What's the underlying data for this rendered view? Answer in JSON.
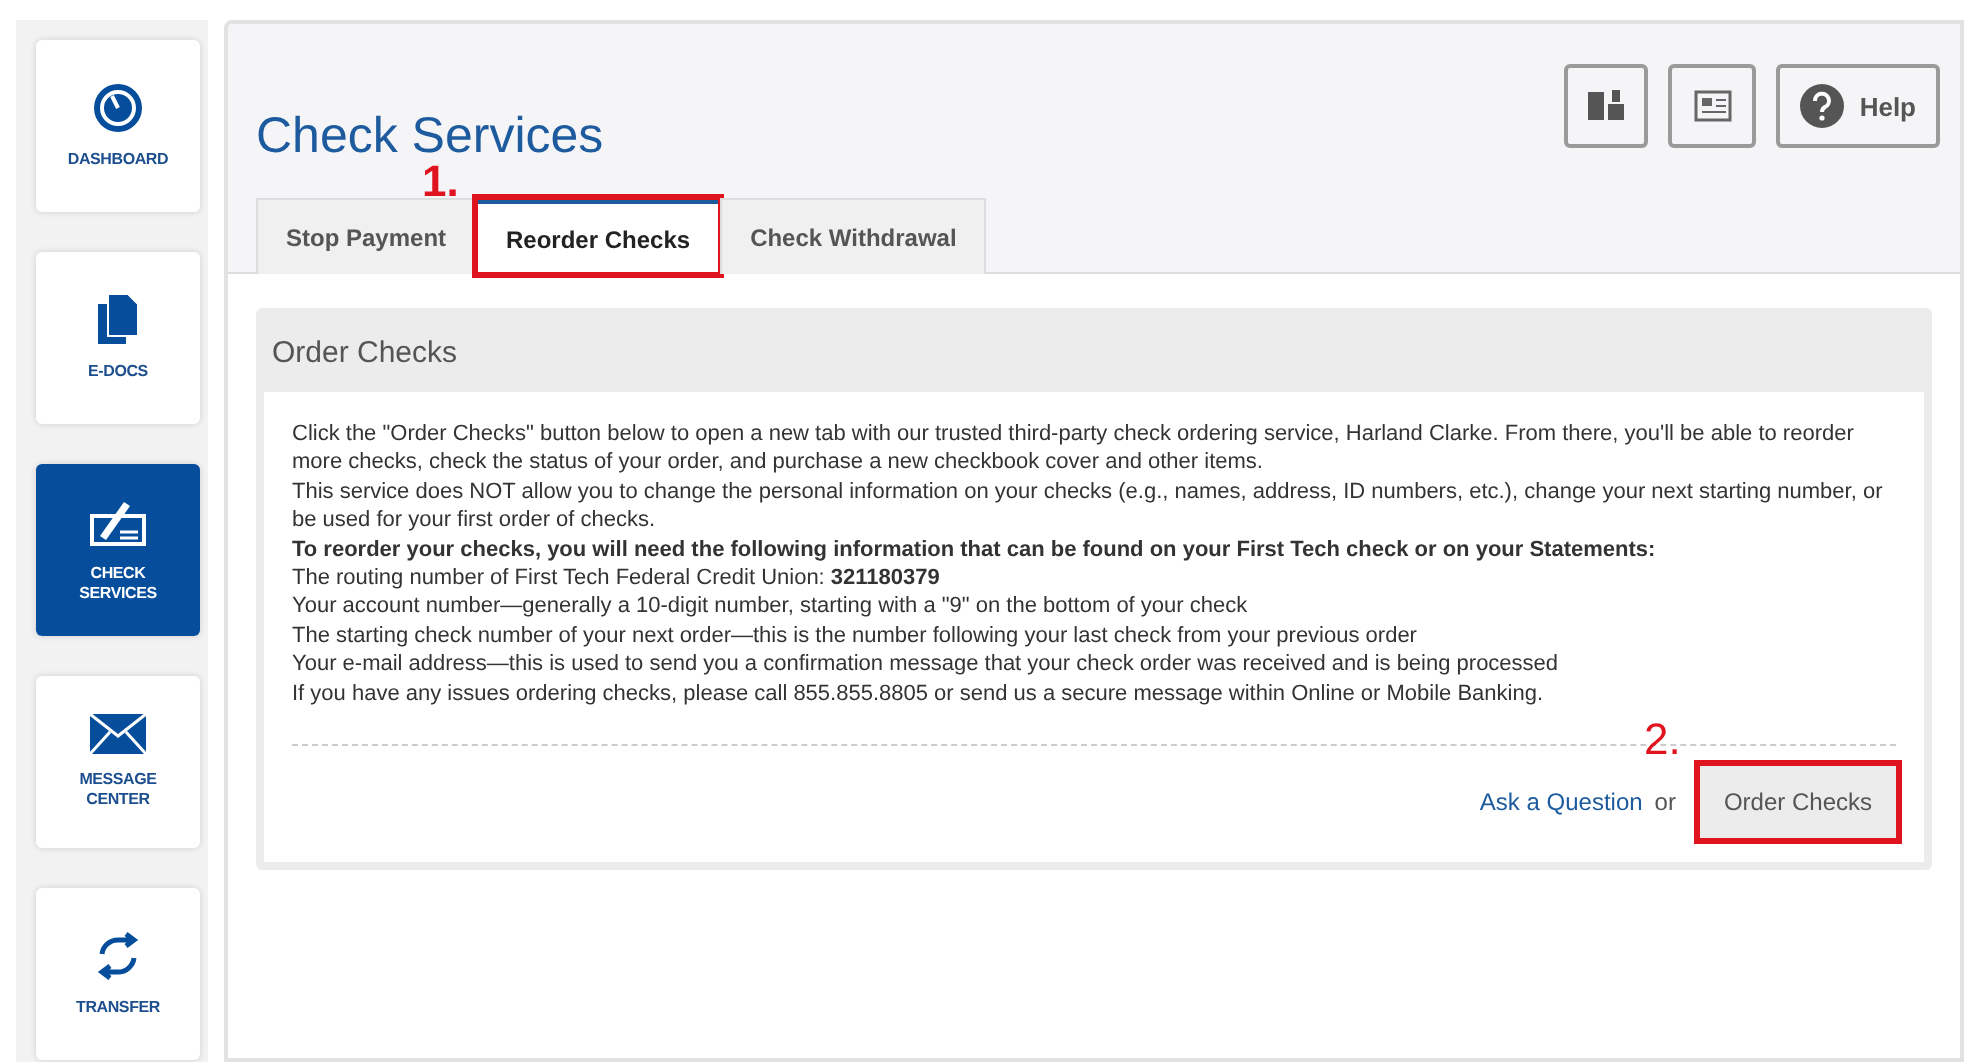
{
  "sidebar": {
    "items": [
      {
        "label": "DASHBOARD",
        "kind": "gauge",
        "selected": false
      },
      {
        "label": "E-DOCS",
        "kind": "docs",
        "selected": false
      },
      {
        "label": "CHECK SERVICES",
        "kind": "check",
        "selected": true
      },
      {
        "label": "MESSAGE CENTER",
        "kind": "mail",
        "selected": false
      },
      {
        "label": "TRANSFER",
        "kind": "transfer",
        "selected": false
      }
    ]
  },
  "header": {
    "title": "Check Services",
    "toolbar": [
      {
        "kind": "book"
      },
      {
        "kind": "news"
      },
      {
        "kind": "help",
        "label": "Help"
      }
    ]
  },
  "tabs": [
    {
      "label": "Stop Payment",
      "selected": false
    },
    {
      "label": "Reorder Checks",
      "selected": true,
      "callout": "1."
    },
    {
      "label": "Check Withdrawal",
      "selected": false
    }
  ],
  "panel": {
    "title": "Order Checks",
    "paragraphs": [
      {
        "text": "Click the \"Order Checks\" button below to open a new tab with our trusted third-party check ordering service, Harland Clarke. From there, you'll be able to reorder more checks, check the status of your order, and purchase a new checkbook cover and other items."
      },
      {
        "text": "This service does NOT allow you to change the personal information on your checks (e.g., names, address, ID numbers, etc.), change your next starting number, or be used for your first order of checks."
      },
      {
        "text": "To reorder your checks, you will need the following information that can be found on your First Tech check or on your Statements:",
        "bold": true
      },
      {
        "text": "The routing number of First Tech Federal Credit Union: **321180379**"
      },
      {
        "text": "Your account number—generally a 10-digit number, starting with a \"9\" on the bottom of your check"
      },
      {
        "text": "The starting check number of your next order—this is the number following your last check from your previous order"
      },
      {
        "text": "Your e-mail address—this is used to send you a confirmation message that your check order was received and is being processed"
      },
      {
        "text": "If you have any issues ordering checks, please call 855.855.8805 or send us a secure message within Online or Mobile Banking."
      }
    ],
    "footer": {
      "link": "Ask a Question",
      "separator": "or",
      "button": "Order Checks",
      "callout": "2."
    }
  }
}
